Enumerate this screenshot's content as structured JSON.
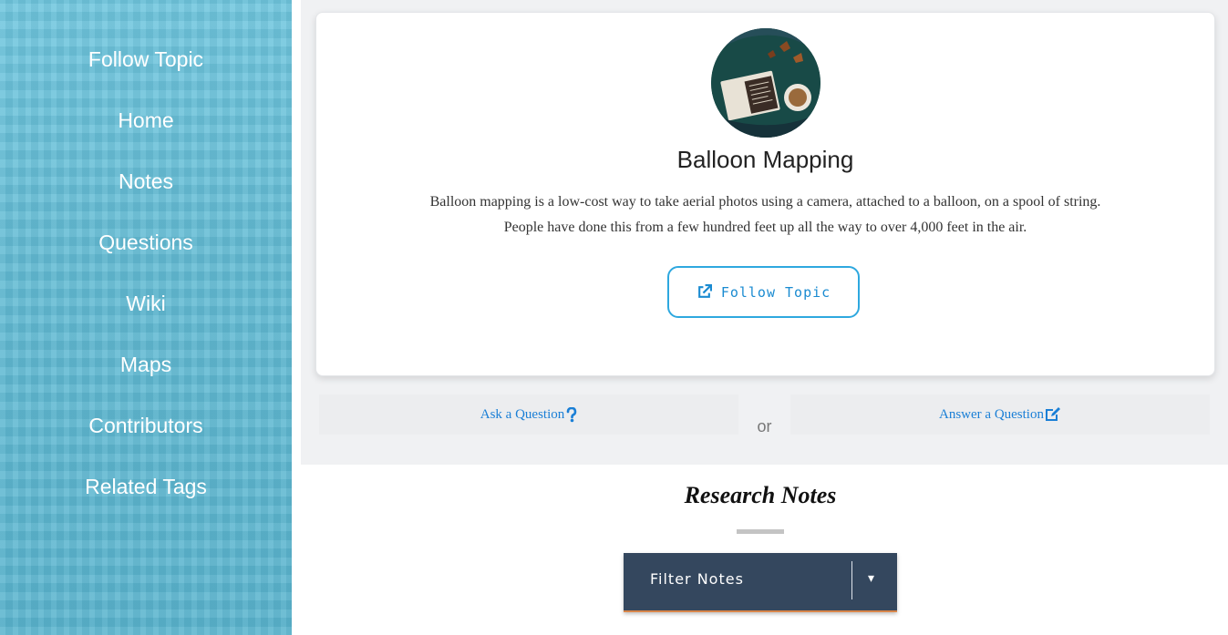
{
  "sidebar": {
    "items": [
      {
        "label": "Follow Topic"
      },
      {
        "label": "Home"
      },
      {
        "label": "Notes"
      },
      {
        "label": "Questions"
      },
      {
        "label": "Wiki"
      },
      {
        "label": "Maps"
      },
      {
        "label": "Contributors"
      },
      {
        "label": "Related Tags"
      }
    ]
  },
  "topic": {
    "title": "Balloon Mapping",
    "description_line1": "Balloon mapping is a low-cost way to take aerial photos using a camera, attached to a balloon, on a spool of string.",
    "description_line2": "People have done this from a few hundred feet up all the way to over 4,000 feet in the air.",
    "follow_button": "Follow Topic",
    "follow_icon": "external-link-icon"
  },
  "questions": {
    "ask_label": "Ask a Question",
    "ask_icon": "question-icon",
    "or_label": "or",
    "answer_label": "Answer a Question",
    "answer_icon": "edit-icon"
  },
  "research": {
    "title": "Research Notes",
    "filter_label": "Filter Notes",
    "filter_arrow": "▾"
  },
  "colors": {
    "accent": "#2ea8df",
    "link": "#1a7fd6",
    "sidebar": "#6cc3da",
    "filter_bg": "#34475e"
  }
}
